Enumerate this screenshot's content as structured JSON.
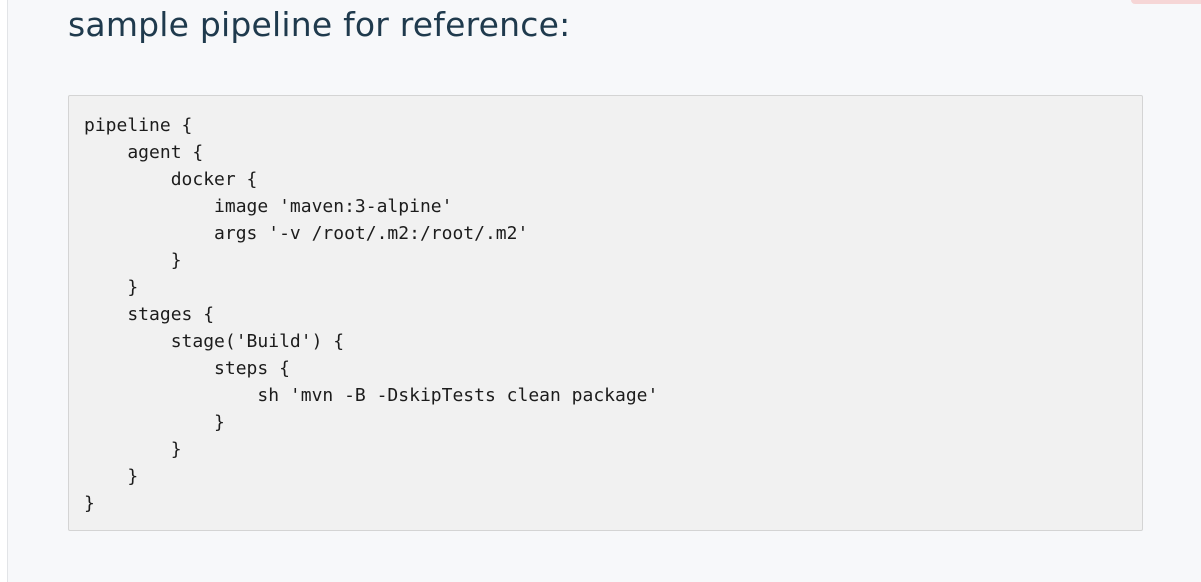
{
  "heading": "sample pipeline for reference:",
  "code_block": {
    "lines": [
      "pipeline {",
      "    agent {",
      "        docker {",
      "            image 'maven:3-alpine'",
      "            args '-v /root/.m2:/root/.m2'",
      "        }",
      "    }",
      "    stages {",
      "        stage('Build') {",
      "            steps {",
      "                sh 'mvn -B -DskipTests clean package'",
      "            }",
      "        }",
      "    }",
      "}"
    ]
  }
}
